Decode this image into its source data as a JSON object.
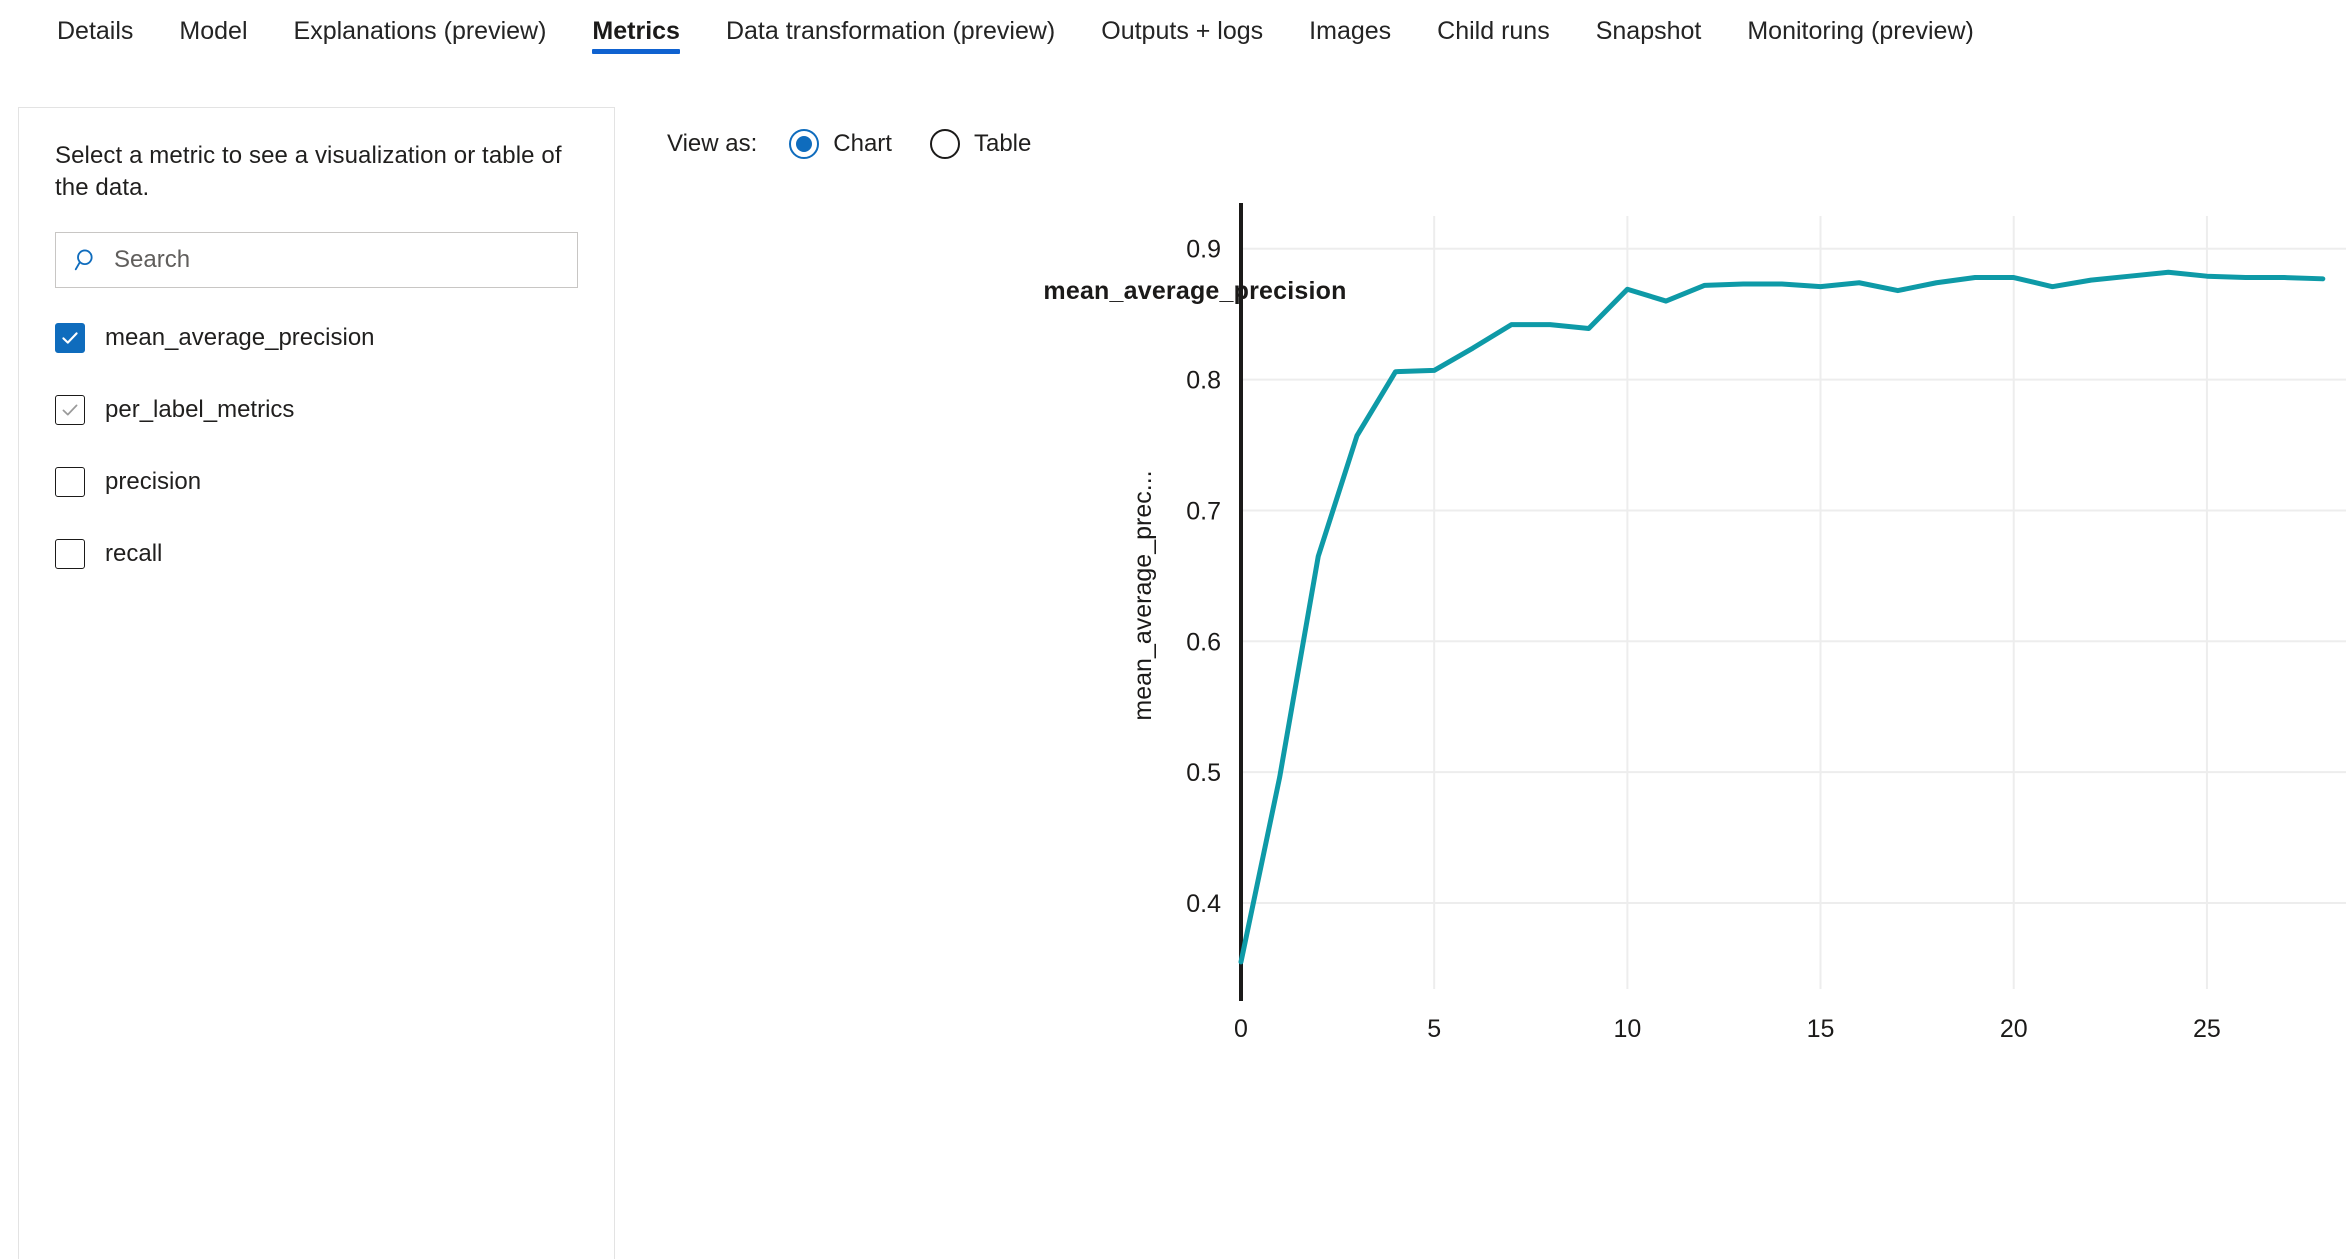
{
  "tabs": [
    {
      "label": "Details",
      "active": false
    },
    {
      "label": "Model",
      "active": false
    },
    {
      "label": "Explanations (preview)",
      "active": false
    },
    {
      "label": "Metrics",
      "active": true
    },
    {
      "label": "Data transformation (preview)",
      "active": false
    },
    {
      "label": "Outputs + logs",
      "active": false
    },
    {
      "label": "Images",
      "active": false
    },
    {
      "label": "Child runs",
      "active": false
    },
    {
      "label": "Snapshot",
      "active": false
    },
    {
      "label": "Monitoring (preview)",
      "active": false
    }
  ],
  "sidebar": {
    "description": "Select a metric to see a visualization or table of the data.",
    "search": {
      "placeholder": "Search",
      "value": "",
      "icon": "search-icon"
    },
    "metrics": [
      {
        "label": "mean_average_precision",
        "state": "checked"
      },
      {
        "label": "per_label_metrics",
        "state": "hover"
      },
      {
        "label": "precision",
        "state": "unchecked"
      },
      {
        "label": "recall",
        "state": "unchecked"
      }
    ]
  },
  "toolbar": {
    "view_as_label": "View as:",
    "options": [
      {
        "label": "Chart",
        "selected": true
      },
      {
        "label": "Table",
        "selected": false
      }
    ]
  },
  "colors": {
    "accent_blue": "#0f6cbd",
    "tab_underline": "#0f62d0",
    "line_teal": "#0e9aa7",
    "gridline": "#ededed",
    "axis": "#1b1a19",
    "panel_border": "#e3e3e3"
  },
  "chart_data": {
    "type": "line",
    "title": "mean_average_precision",
    "xlabel": "",
    "ylabel": "mean_average_prec...",
    "ylabel_full": "mean_average_precision",
    "xlim": [
      0,
      28.6
    ],
    "ylim": [
      0.345,
      0.925
    ],
    "grid": true,
    "legend": false,
    "xticks": [
      0,
      5,
      10,
      15,
      20,
      25
    ],
    "yticks": [
      0.4,
      0.5,
      0.6,
      0.7,
      0.8,
      0.9
    ],
    "x": [
      0,
      1,
      2,
      3,
      4,
      5,
      6,
      7,
      8,
      9,
      10,
      11,
      12,
      13,
      14,
      15,
      16,
      17,
      18,
      19,
      20,
      21,
      22,
      23,
      24,
      25,
      26,
      27,
      28
    ],
    "series": [
      {
        "name": "mean_average_precision",
        "color": "#0e9aa7",
        "values": [
          0.355,
          0.496,
          0.665,
          0.757,
          0.806,
          0.807,
          0.824,
          0.842,
          0.842,
          0.839,
          0.869,
          0.86,
          0.872,
          0.873,
          0.873,
          0.871,
          0.874,
          0.868,
          0.874,
          0.878,
          0.878,
          0.871,
          0.876,
          0.879,
          0.882,
          0.879,
          0.878,
          0.878,
          0.877
        ]
      }
    ]
  }
}
